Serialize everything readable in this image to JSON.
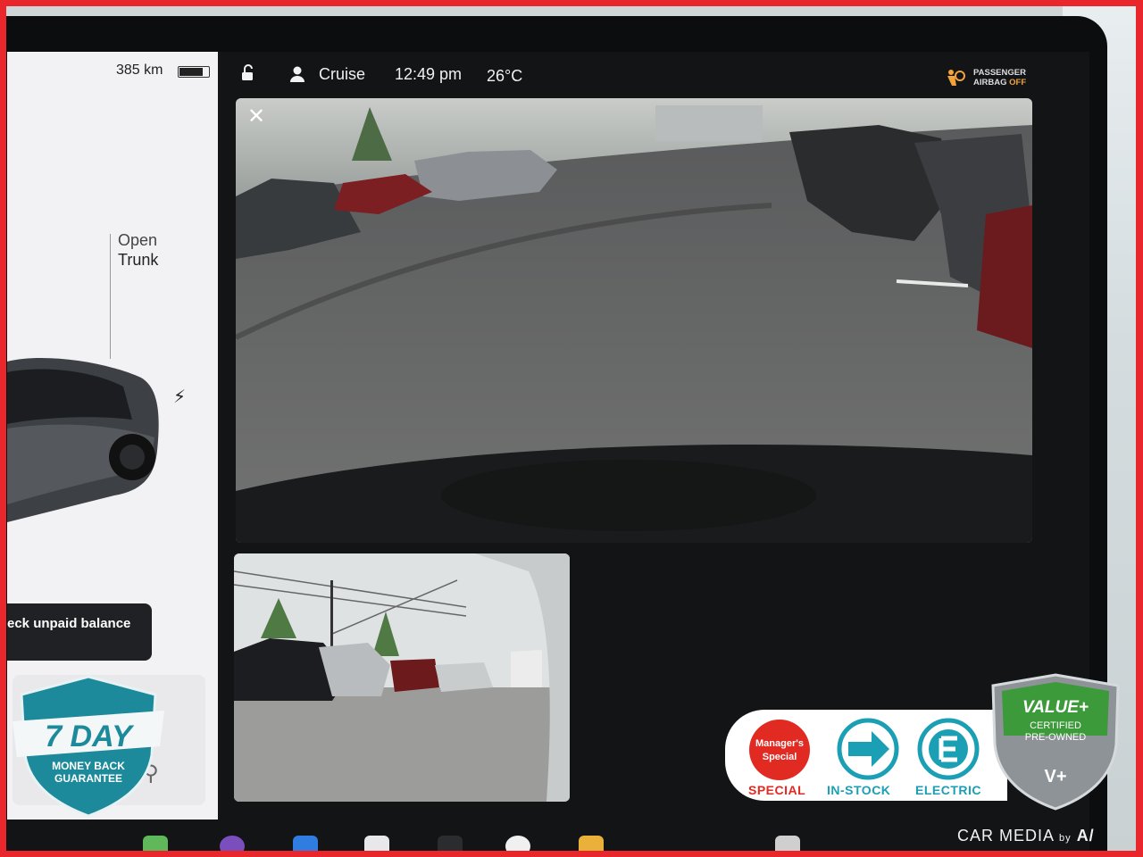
{
  "left_panel": {
    "range": "385 km",
    "battery_level": 0.82,
    "trunk_line1": "Open",
    "trunk_line2": "Trunk",
    "unpaid_button": "eck unpaid balance"
  },
  "status_bar": {
    "profile": "Cruise",
    "time": "12:49 pm",
    "temperature": "26°C",
    "airbag_line1": "PASSENGER",
    "airbag_line2": "AIRBAG",
    "airbag_state": "OFF"
  },
  "camera": {
    "close_symbol": "✕"
  },
  "overlays": {
    "seven_day_big": "7 DAY",
    "seven_day_small1": "MONEY BACK",
    "seven_day_small2": "GUARANTEE",
    "managers_special_line1": "Manager's",
    "managers_special_line2": "Special",
    "label_special": "SPECIAL",
    "label_instock": "IN-STOCK",
    "label_electric": "ELECTRIC",
    "value_title": "VALUE+",
    "value_sub1": "CERTIFIED",
    "value_sub2": "PRE-OWNED",
    "value_mark": "V+",
    "watermark": "CAR MEDIA",
    "watermark_by": "by"
  },
  "colors": {
    "frame": "#e8262b",
    "special": "#e02a22",
    "instock": "#1a9fb5",
    "electric": "#1a9fb5",
    "value_green": "#3c9a3a",
    "airbag_off": "#f2a33a"
  },
  "icons": [
    "lock-icon",
    "person-icon",
    "airbag-icon",
    "close-icon",
    "lightning-bolt-icon",
    "search-icon",
    "shield-icon",
    "arrow-right-icon",
    "electric-e-icon"
  ]
}
